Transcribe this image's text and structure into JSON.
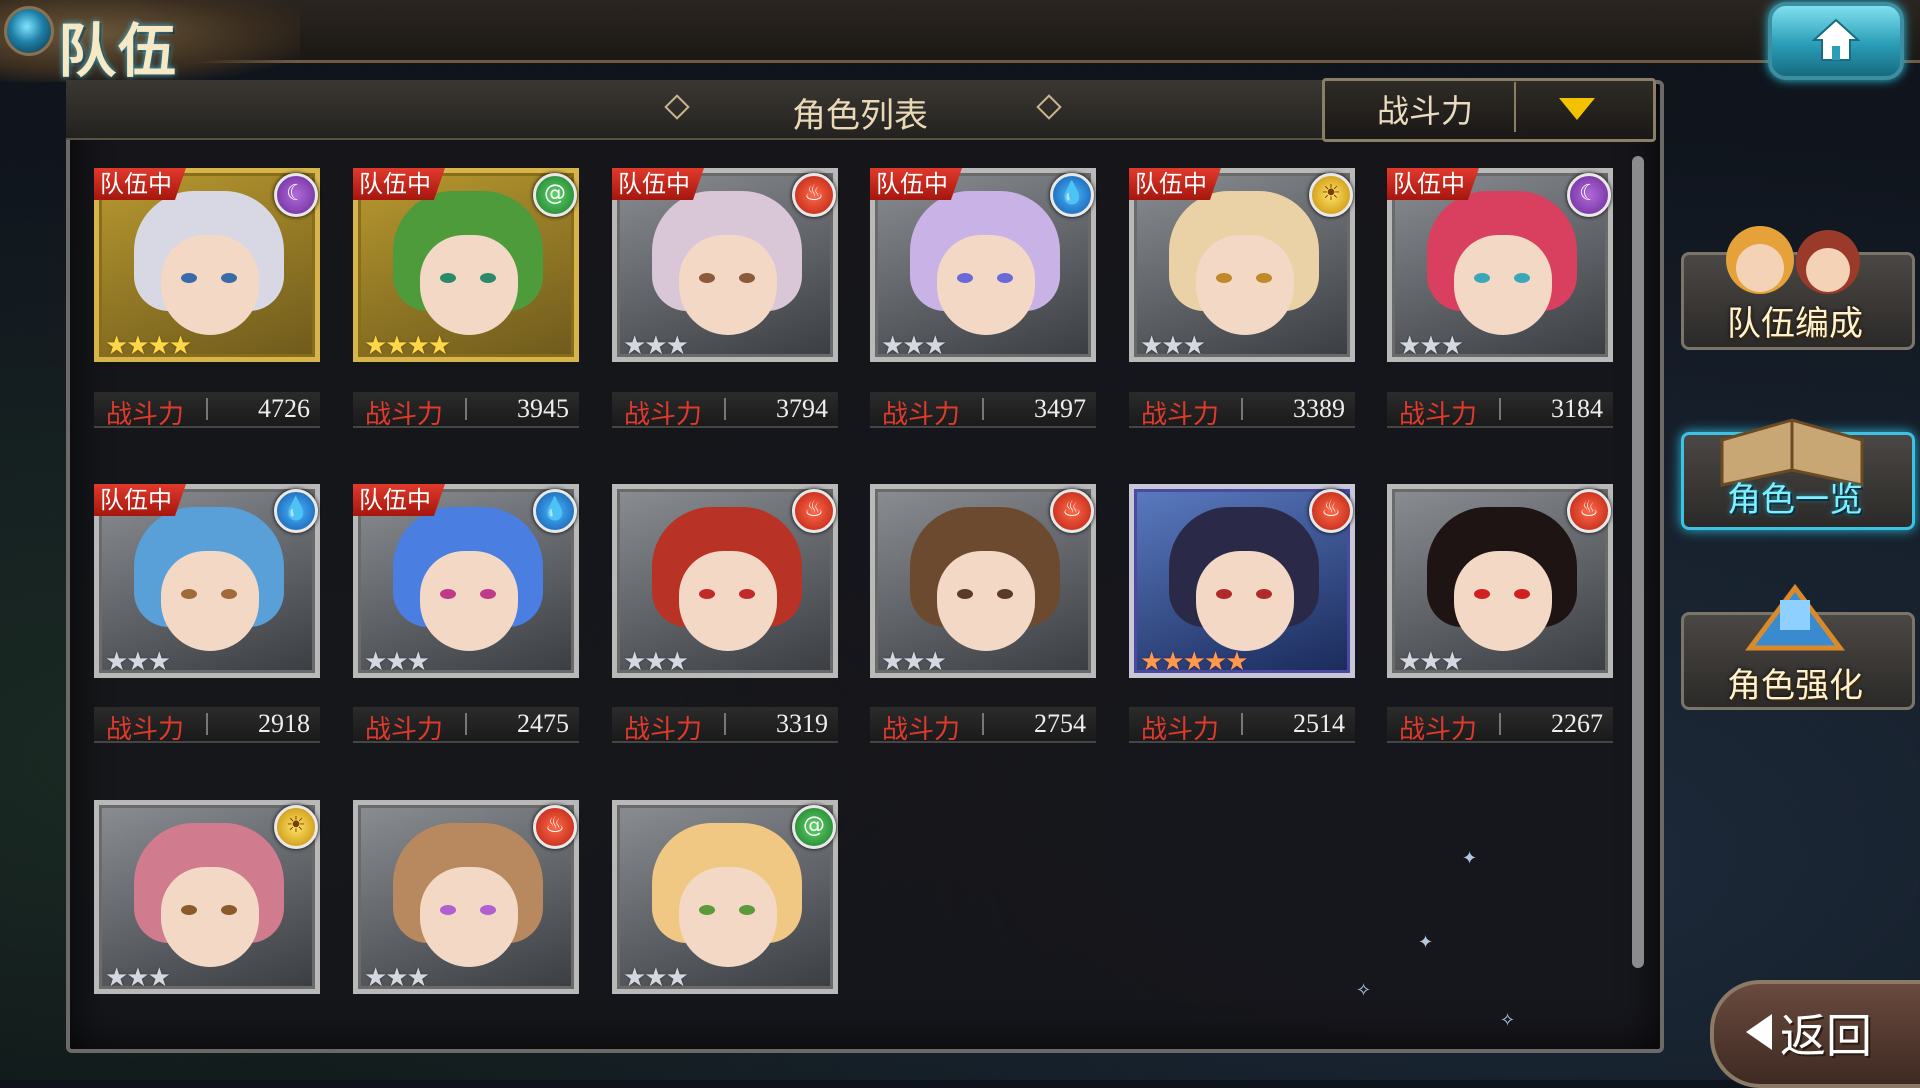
{
  "header": {
    "title": "队伍"
  },
  "list": {
    "title": "角色列表",
    "sort_label": "战斗力"
  },
  "power_label": "战斗力",
  "team_badge": "队伍中",
  "side_menu": [
    {
      "label": "队伍编成",
      "active": false
    },
    {
      "label": "角色一览",
      "active": true
    },
    {
      "label": "角色强化",
      "active": false
    }
  ],
  "back_label": "返回",
  "characters": [
    {
      "in_team": true,
      "element": "moon-icon",
      "stars": 4,
      "power": "4726"
    },
    {
      "in_team": true,
      "element": "wind-icon",
      "stars": 4,
      "power": "3945"
    },
    {
      "in_team": true,
      "element": "fire-icon",
      "stars": 3,
      "power": "3794"
    },
    {
      "in_team": true,
      "element": "water-icon",
      "stars": 3,
      "power": "3497"
    },
    {
      "in_team": true,
      "element": "sun-icon",
      "stars": 3,
      "power": "3389"
    },
    {
      "in_team": true,
      "element": "moon-icon",
      "stars": 3,
      "power": "3184"
    },
    {
      "in_team": true,
      "element": "water-icon",
      "stars": 3,
      "power": "2918"
    },
    {
      "in_team": true,
      "element": "water-icon",
      "stars": 3,
      "power": "2475"
    },
    {
      "in_team": false,
      "element": "fire-icon",
      "stars": 3,
      "power": "3319"
    },
    {
      "in_team": false,
      "element": "fire-icon",
      "stars": 3,
      "power": "2754"
    },
    {
      "in_team": false,
      "element": "fire-icon",
      "stars": 5,
      "power": "2514"
    },
    {
      "in_team": false,
      "element": "fire-icon",
      "stars": 3,
      "power": "2267"
    },
    {
      "in_team": false,
      "element": "sun-icon",
      "stars": 3,
      "power": ""
    },
    {
      "in_team": false,
      "element": "fire-icon",
      "stars": 3,
      "power": ""
    },
    {
      "in_team": false,
      "element": "wind-icon",
      "stars": 3,
      "power": ""
    }
  ]
}
